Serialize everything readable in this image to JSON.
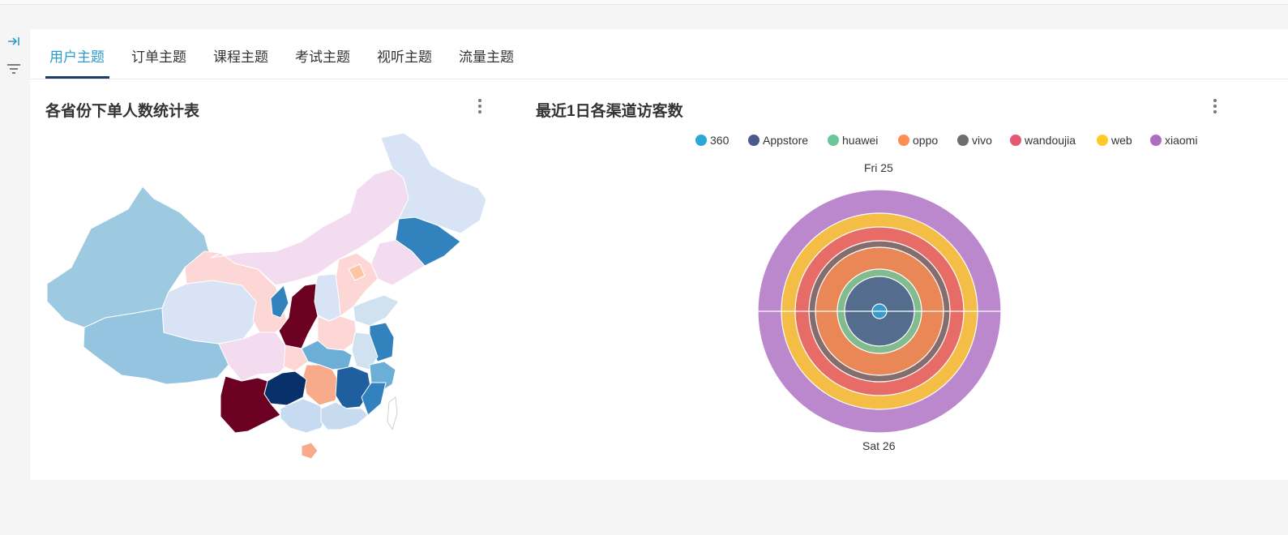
{
  "sidebar": {
    "collapse_icon": "collapse-right-icon",
    "filter_icon": "filter-icon"
  },
  "tabs": [
    {
      "label": "用户主题",
      "active": true
    },
    {
      "label": "订单主题"
    },
    {
      "label": "课程主题"
    },
    {
      "label": "考试主题"
    },
    {
      "label": "视听主题"
    },
    {
      "label": "流量主题"
    }
  ],
  "colors": {
    "accent": "#2a9cc9",
    "tab_ink": "#1f3a6b"
  },
  "map_card": {
    "title": "各省份下单人数统计表"
  },
  "pie_card": {
    "title": "最近1日各渠道访客数"
  },
  "chart_data": [
    {
      "type": "map",
      "title": "各省份下单人数统计表",
      "region": "China provinces",
      "color_scale": [
        "#6b0022",
        "#fdd6d6",
        "#f3dbf0",
        "#d8e3f5",
        "#9ecae1",
        "#3182bd",
        "#08306b"
      ]
    },
    {
      "type": "pie",
      "title": "最近1日各渠道访客数",
      "series_style": "nested concentric rings (polar)",
      "angle_labels": [
        "Fri 25",
        "Sat 26"
      ],
      "categories": [
        "360",
        "Appstore",
        "huawei",
        "oppo",
        "vivo",
        "wandoujia",
        "web",
        "xiaomi"
      ],
      "colors": [
        "#2ea7d8",
        "#4a5a8e",
        "#6bc79a",
        "#ff8d52",
        "#6e6e6e",
        "#e4596f",
        "#ffc928",
        "#ad6ec2"
      ],
      "ring_order_inner_to_outer": [
        "360",
        "Appstore",
        "huawei",
        "oppo",
        "vivo",
        "wandoujia",
        "web",
        "xiaomi"
      ]
    }
  ]
}
